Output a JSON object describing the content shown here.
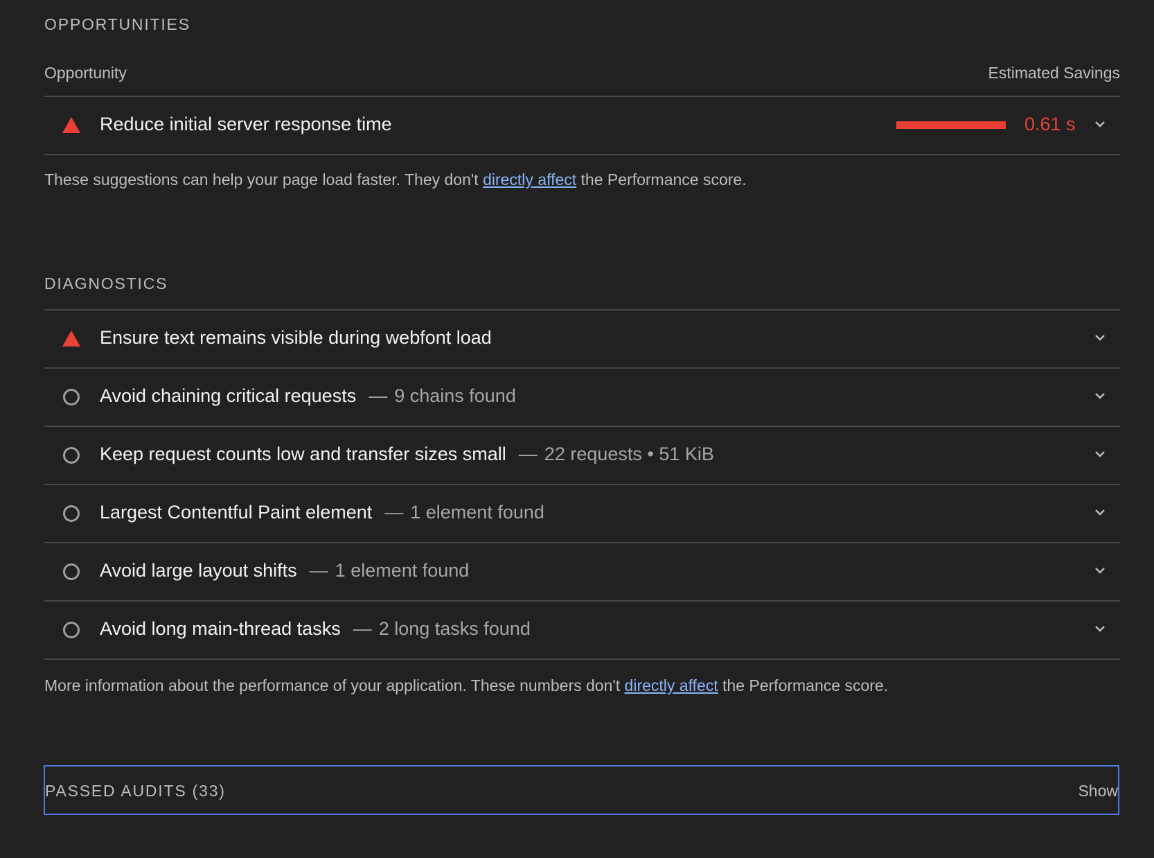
{
  "opportunities": {
    "title": "OPPORTUNITIES",
    "col_left": "Opportunity",
    "col_right": "Estimated Savings",
    "items": [
      {
        "label": "Reduce initial server response time",
        "savings": "0.61 s",
        "icon": "warning-triangle-icon"
      }
    ],
    "desc_before": "These suggestions can help your page load faster. They don't ",
    "desc_link": "directly affect",
    "desc_after": " the Performance score."
  },
  "diagnostics": {
    "title": "DIAGNOSTICS",
    "items": [
      {
        "label": "Ensure text remains visible during webfont load",
        "meta": "",
        "icon": "warning-triangle-icon"
      },
      {
        "label": "Avoid chaining critical requests",
        "meta": "9 chains found",
        "icon": "info-circle-icon"
      },
      {
        "label": "Keep request counts low and transfer sizes small",
        "meta": "22 requests • 51 KiB",
        "icon": "info-circle-icon"
      },
      {
        "label": "Largest Contentful Paint element",
        "meta": "1 element found",
        "icon": "info-circle-icon"
      },
      {
        "label": "Avoid large layout shifts",
        "meta": "1 element found",
        "icon": "info-circle-icon"
      },
      {
        "label": "Avoid long main-thread tasks",
        "meta": "2 long tasks found",
        "icon": "info-circle-icon"
      }
    ],
    "separator": "—",
    "desc_before": "More information about the performance of your application. These numbers don't ",
    "desc_link": "directly affect",
    "desc_after": " the Performance score."
  },
  "passed": {
    "title": "PASSED AUDITS (33)",
    "show_label": "Show"
  },
  "colors": {
    "background": "#212121",
    "fail": "#eb4036",
    "neutral": "#9e9e9e",
    "link": "#8ab4f8",
    "focus": "#4c7bd9"
  }
}
